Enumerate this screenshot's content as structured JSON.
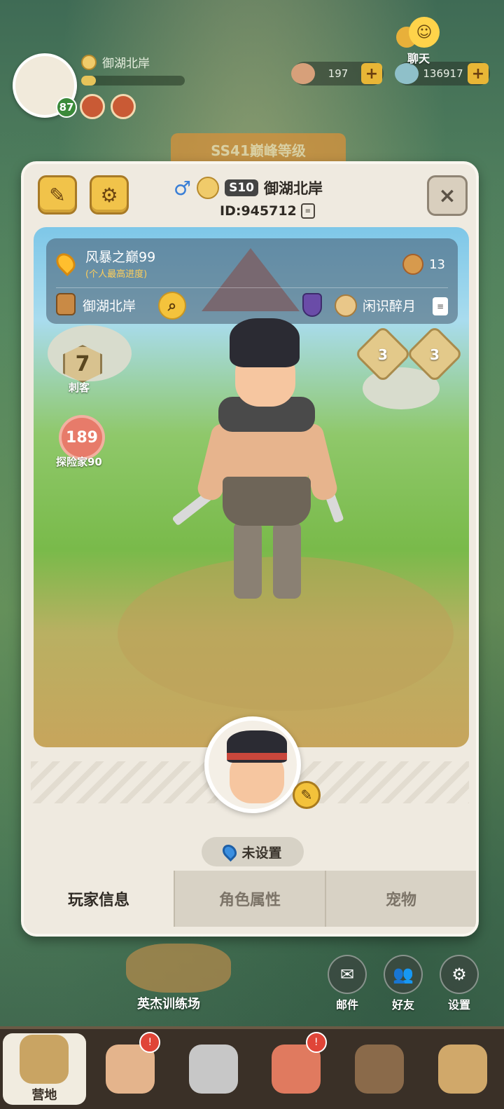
{
  "hud": {
    "player_name": "御湖北岸",
    "level": "87",
    "exp_progress": 0.14,
    "resource1_value": "197",
    "resource2_value": "136917",
    "plus": "+",
    "chat_label": "聊天",
    "banner_text": "SS41巅峰等级"
  },
  "profile": {
    "gender_symbol": "♂",
    "season": "S10",
    "name": "御湖北岸",
    "id_text": "ID:945712",
    "close_symbol": "×",
    "location_name": "风暴之巅99",
    "location_sub": "(个人最高进度)",
    "likes": "13",
    "guild_name": "御湖北岸",
    "partner_name": "闲识醉月",
    "class_number": "7",
    "class_label": "刺客",
    "rank_number": "189",
    "rank_label": "探险家90",
    "badge1_value": "3",
    "badge2_value": "3",
    "location_setting": "未设置"
  },
  "tabs": [
    {
      "label": "玩家信息",
      "active": true
    },
    {
      "label": "角色属性",
      "active": false
    },
    {
      "label": "宠物",
      "active": false
    }
  ],
  "quick_actions": [
    {
      "label": "邮件",
      "icon": "mail-icon"
    },
    {
      "label": "好友",
      "icon": "friends-icon"
    },
    {
      "label": "设置",
      "icon": "gear-icon"
    }
  ],
  "training_label": "英杰训练场",
  "nav": [
    {
      "label": "营地",
      "icon": "camp-icon",
      "active": true
    },
    {
      "label": "",
      "icon": "hero-icon",
      "badge": "!"
    },
    {
      "label": "",
      "icon": "weapon-icon"
    },
    {
      "label": "",
      "icon": "pet-icon",
      "badge": "!"
    },
    {
      "label": "",
      "icon": "shop-icon"
    },
    {
      "label": "",
      "icon": "guild-icon"
    }
  ],
  "colors": {
    "accent_gold": "#f1c34a",
    "card_bg": "#efeae0",
    "level_green": "#3b8a3a"
  }
}
